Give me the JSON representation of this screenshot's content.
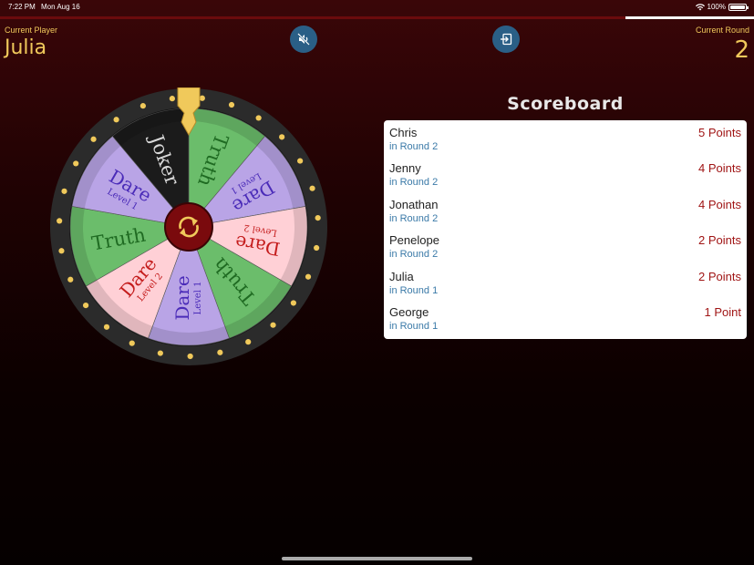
{
  "status": {
    "time": "7:22 PM",
    "date": "Mon Aug 16",
    "battery": "100%"
  },
  "progress": {
    "fraction": 0.17
  },
  "current_player": {
    "label": "Current Player",
    "name": "Julia"
  },
  "current_round": {
    "label": "Current Round",
    "value": "2"
  },
  "buttons": {
    "mute_icon": "speaker-mute-icon",
    "exit_icon": "exit-icon"
  },
  "colors": {
    "accent": "#f0c95b",
    "button": "#2a5f86",
    "points": "#a01515",
    "round": "#3b7aa8",
    "hub": "#7a0a0d"
  },
  "wheel": {
    "segments": [
      {
        "label": "Truth",
        "sub": "",
        "fill": "#6bbd6b",
        "text": "#1f6b22"
      },
      {
        "label": "Dare",
        "sub": "Level 1",
        "fill": "#b9a4e6",
        "text": "#4a2bb8"
      },
      {
        "label": "Dare",
        "sub": "Level 2",
        "fill": "#ffd0d6",
        "text": "#c41c1c"
      },
      {
        "label": "Truth",
        "sub": "",
        "fill": "#6bbd6b",
        "text": "#1f6b22"
      },
      {
        "label": "Dare",
        "sub": "Level 1",
        "fill": "#b9a4e6",
        "text": "#4a2bb8"
      },
      {
        "label": "Dare",
        "sub": "Level 2",
        "fill": "#ffd0d6",
        "text": "#c41c1c"
      },
      {
        "label": "Truth",
        "sub": "",
        "fill": "#6bbd6b",
        "text": "#1f6b22"
      },
      {
        "label": "Dare",
        "sub": "Level 1",
        "fill": "#b9a4e6",
        "text": "#4a2bb8"
      },
      {
        "label": "Joker",
        "sub": "",
        "fill": "#1b1b1b",
        "text": "#d8d8d8"
      }
    ],
    "spin_icon": "spin-arrows-icon",
    "pointer_icon": "pointer-icon"
  },
  "scoreboard": {
    "title": "Scoreboard",
    "rows": [
      {
        "name": "Chris",
        "round": "in Round 2",
        "points": "5 Points"
      },
      {
        "name": "Jenny",
        "round": "in Round 2",
        "points": "4 Points"
      },
      {
        "name": "Jonathan",
        "round": "in Round 2",
        "points": "4 Points"
      },
      {
        "name": "Penelope",
        "round": "in Round 2",
        "points": "2 Points"
      },
      {
        "name": "Julia",
        "round": "in Round 1",
        "points": "2 Points"
      },
      {
        "name": "George",
        "round": "in Round 1",
        "points": "1 Point"
      }
    ]
  }
}
